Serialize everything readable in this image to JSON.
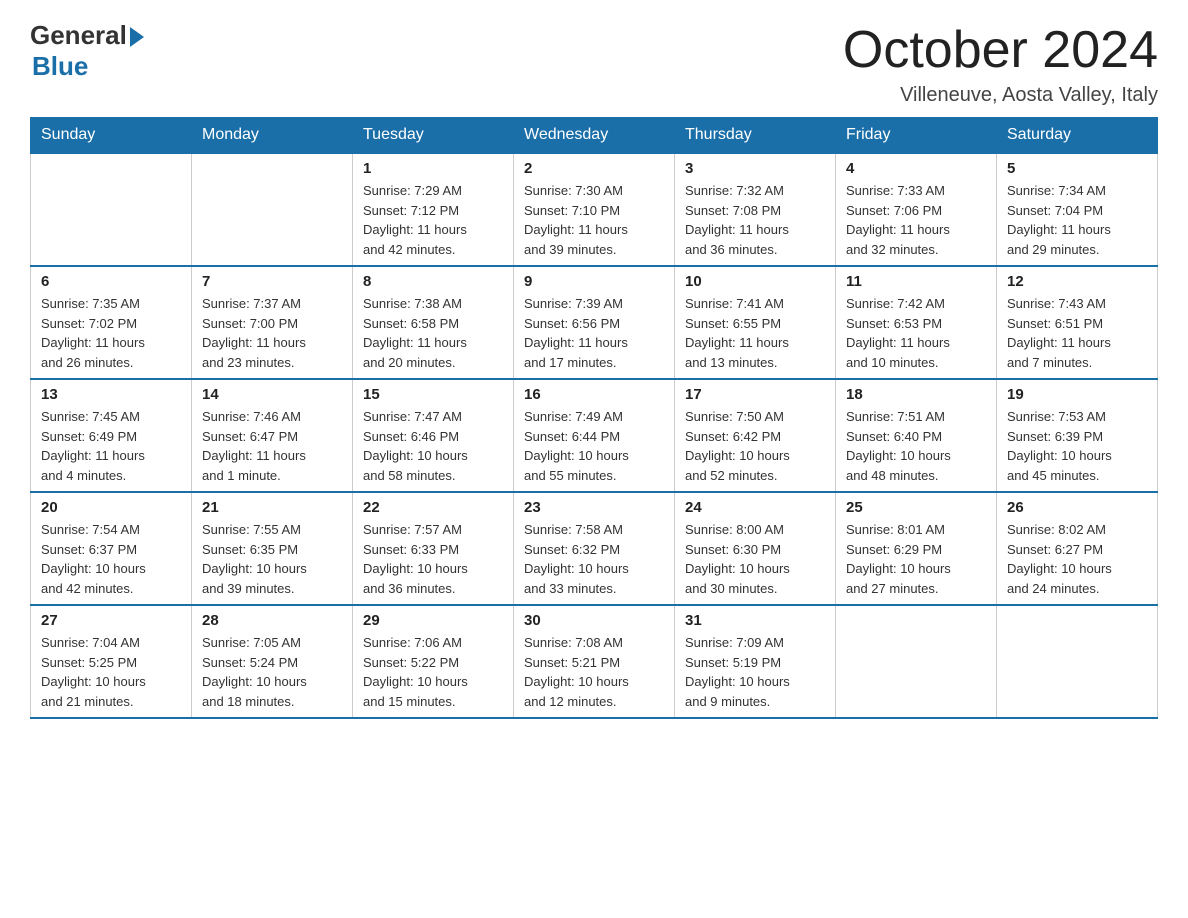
{
  "logo": {
    "general": "General",
    "blue": "Blue"
  },
  "title": "October 2024",
  "location": "Villeneuve, Aosta Valley, Italy",
  "days_header": [
    "Sunday",
    "Monday",
    "Tuesday",
    "Wednesday",
    "Thursday",
    "Friday",
    "Saturday"
  ],
  "weeks": [
    [
      {
        "day": "",
        "info": ""
      },
      {
        "day": "",
        "info": ""
      },
      {
        "day": "1",
        "info": "Sunrise: 7:29 AM\nSunset: 7:12 PM\nDaylight: 11 hours\nand 42 minutes."
      },
      {
        "day": "2",
        "info": "Sunrise: 7:30 AM\nSunset: 7:10 PM\nDaylight: 11 hours\nand 39 minutes."
      },
      {
        "day": "3",
        "info": "Sunrise: 7:32 AM\nSunset: 7:08 PM\nDaylight: 11 hours\nand 36 minutes."
      },
      {
        "day": "4",
        "info": "Sunrise: 7:33 AM\nSunset: 7:06 PM\nDaylight: 11 hours\nand 32 minutes."
      },
      {
        "day": "5",
        "info": "Sunrise: 7:34 AM\nSunset: 7:04 PM\nDaylight: 11 hours\nand 29 minutes."
      }
    ],
    [
      {
        "day": "6",
        "info": "Sunrise: 7:35 AM\nSunset: 7:02 PM\nDaylight: 11 hours\nand 26 minutes."
      },
      {
        "day": "7",
        "info": "Sunrise: 7:37 AM\nSunset: 7:00 PM\nDaylight: 11 hours\nand 23 minutes."
      },
      {
        "day": "8",
        "info": "Sunrise: 7:38 AM\nSunset: 6:58 PM\nDaylight: 11 hours\nand 20 minutes."
      },
      {
        "day": "9",
        "info": "Sunrise: 7:39 AM\nSunset: 6:56 PM\nDaylight: 11 hours\nand 17 minutes."
      },
      {
        "day": "10",
        "info": "Sunrise: 7:41 AM\nSunset: 6:55 PM\nDaylight: 11 hours\nand 13 minutes."
      },
      {
        "day": "11",
        "info": "Sunrise: 7:42 AM\nSunset: 6:53 PM\nDaylight: 11 hours\nand 10 minutes."
      },
      {
        "day": "12",
        "info": "Sunrise: 7:43 AM\nSunset: 6:51 PM\nDaylight: 11 hours\nand 7 minutes."
      }
    ],
    [
      {
        "day": "13",
        "info": "Sunrise: 7:45 AM\nSunset: 6:49 PM\nDaylight: 11 hours\nand 4 minutes."
      },
      {
        "day": "14",
        "info": "Sunrise: 7:46 AM\nSunset: 6:47 PM\nDaylight: 11 hours\nand 1 minute."
      },
      {
        "day": "15",
        "info": "Sunrise: 7:47 AM\nSunset: 6:46 PM\nDaylight: 10 hours\nand 58 minutes."
      },
      {
        "day": "16",
        "info": "Sunrise: 7:49 AM\nSunset: 6:44 PM\nDaylight: 10 hours\nand 55 minutes."
      },
      {
        "day": "17",
        "info": "Sunrise: 7:50 AM\nSunset: 6:42 PM\nDaylight: 10 hours\nand 52 minutes."
      },
      {
        "day": "18",
        "info": "Sunrise: 7:51 AM\nSunset: 6:40 PM\nDaylight: 10 hours\nand 48 minutes."
      },
      {
        "day": "19",
        "info": "Sunrise: 7:53 AM\nSunset: 6:39 PM\nDaylight: 10 hours\nand 45 minutes."
      }
    ],
    [
      {
        "day": "20",
        "info": "Sunrise: 7:54 AM\nSunset: 6:37 PM\nDaylight: 10 hours\nand 42 minutes."
      },
      {
        "day": "21",
        "info": "Sunrise: 7:55 AM\nSunset: 6:35 PM\nDaylight: 10 hours\nand 39 minutes."
      },
      {
        "day": "22",
        "info": "Sunrise: 7:57 AM\nSunset: 6:33 PM\nDaylight: 10 hours\nand 36 minutes."
      },
      {
        "day": "23",
        "info": "Sunrise: 7:58 AM\nSunset: 6:32 PM\nDaylight: 10 hours\nand 33 minutes."
      },
      {
        "day": "24",
        "info": "Sunrise: 8:00 AM\nSunset: 6:30 PM\nDaylight: 10 hours\nand 30 minutes."
      },
      {
        "day": "25",
        "info": "Sunrise: 8:01 AM\nSunset: 6:29 PM\nDaylight: 10 hours\nand 27 minutes."
      },
      {
        "day": "26",
        "info": "Sunrise: 8:02 AM\nSunset: 6:27 PM\nDaylight: 10 hours\nand 24 minutes."
      }
    ],
    [
      {
        "day": "27",
        "info": "Sunrise: 7:04 AM\nSunset: 5:25 PM\nDaylight: 10 hours\nand 21 minutes."
      },
      {
        "day": "28",
        "info": "Sunrise: 7:05 AM\nSunset: 5:24 PM\nDaylight: 10 hours\nand 18 minutes."
      },
      {
        "day": "29",
        "info": "Sunrise: 7:06 AM\nSunset: 5:22 PM\nDaylight: 10 hours\nand 15 minutes."
      },
      {
        "day": "30",
        "info": "Sunrise: 7:08 AM\nSunset: 5:21 PM\nDaylight: 10 hours\nand 12 minutes."
      },
      {
        "day": "31",
        "info": "Sunrise: 7:09 AM\nSunset: 5:19 PM\nDaylight: 10 hours\nand 9 minutes."
      },
      {
        "day": "",
        "info": ""
      },
      {
        "day": "",
        "info": ""
      }
    ]
  ]
}
